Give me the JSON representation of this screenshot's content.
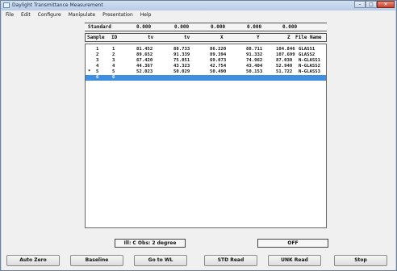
{
  "window": {
    "title": "Daylight Transmittance Measurement",
    "buttons": {
      "minimize": "–",
      "maximize": "□",
      "close": "✕"
    }
  },
  "menu": [
    "File",
    "Edit",
    "Configure",
    "Manipulate",
    "Presentation",
    "Help"
  ],
  "standard_row": {
    "label": "Standard",
    "values": [
      "0.000",
      "0.000",
      "0.000",
      "0.000",
      "0.000"
    ]
  },
  "columns": [
    "Sample",
    "ID",
    "tv",
    "tv",
    "X",
    "Y",
    "Z",
    "File Name"
  ],
  "rows": [
    {
      "marker": "",
      "sample": "1",
      "id": "1",
      "tv1": "81.452",
      "tv2": "88.733",
      "x": "86.220",
      "y": "88.711",
      "z": "104.846",
      "file": "GLASS1"
    },
    {
      "marker": "",
      "sample": "2",
      "id": "2",
      "tv1": "89.652",
      "tv2": "91.339",
      "x": "89.394",
      "y": "91.332",
      "z": "107.699",
      "file": "GLASS2"
    },
    {
      "marker": "",
      "sample": "3",
      "id": "3",
      "tv1": "67.420",
      "tv2": "75.051",
      "x": "69.073",
      "y": "74.962",
      "z": "87.030",
      "file": "N-GLASS1"
    },
    {
      "marker": "",
      "sample": "4",
      "id": "4",
      "tv1": "44.367",
      "tv2": "43.323",
      "x": "42.754",
      "y": "43.404",
      "z": "52.940",
      "file": "N-GLASS2"
    },
    {
      "marker": "*",
      "sample": "5",
      "id": "5",
      "tv1": "52.023",
      "tv2": "50.029",
      "x": "50.490",
      "y": "50.153",
      "z": "51.722",
      "file": "N-GLASS3"
    },
    {
      "marker": "",
      "sample": "6",
      "id": "6",
      "tv1": "",
      "tv2": "",
      "x": "",
      "y": "",
      "z": "",
      "file": ""
    }
  ],
  "status": {
    "illuminant": "Ill: C   Obs: 2 degree",
    "state": "OFF"
  },
  "buttons": [
    "Auto Zero",
    "Baseline",
    "Go to WL",
    "STD Read",
    "UNK Read",
    "Stop"
  ]
}
